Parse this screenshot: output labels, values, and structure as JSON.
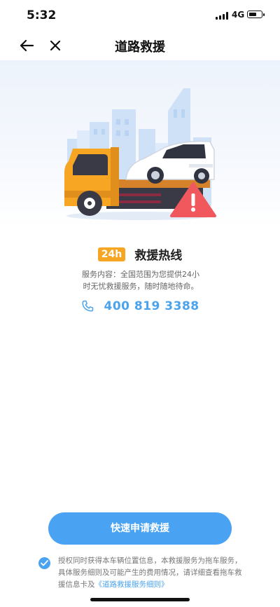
{
  "status": {
    "time": "5:32",
    "network": "4G",
    "battery_level": 0.65
  },
  "nav": {
    "back_icon": "arrow-left-icon",
    "close_icon": "close-icon",
    "title": "道路救援"
  },
  "hero": {
    "illustration": "tow-truck-illustration",
    "warning_icon": "warning-triangle-icon"
  },
  "hotline": {
    "badge": "24h",
    "title": "救援热线",
    "service_desc": "服务内容：全国范围为您提供24小时无忧救援服务，随时随地待命。",
    "phone_icon": "phone-icon",
    "phone_number": "400 819 3388"
  },
  "cta": {
    "label": "快速申请救援"
  },
  "consent": {
    "checked": true,
    "text": "授权同时获得本车辆位置信息，本救援服务为拖车服务，具体服务细则及可能产生的费用情况，请详细查看拖车救援信息卡及",
    "link": "《道路救援服务细则》"
  },
  "colors": {
    "accent": "#4aa3f2",
    "badge": "#f6a623",
    "truck": "#f6a623",
    "warning": "#f0585d"
  }
}
